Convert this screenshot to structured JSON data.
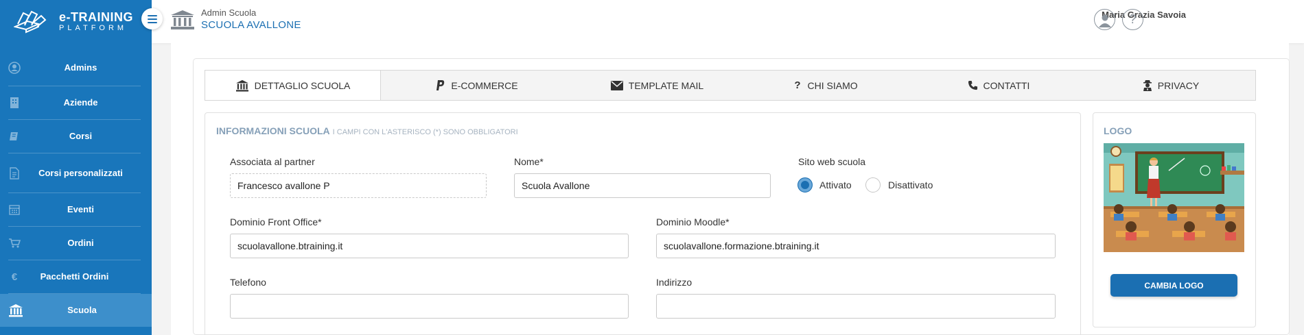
{
  "brand": {
    "title": "e-TRAINING",
    "subtitle": "PLATFORM"
  },
  "header": {
    "role": "Admin Scuola",
    "school": "SCUOLA AVALLONE",
    "user": "Maria Grazia Savoia",
    "help": "?"
  },
  "sidebar": {
    "items": [
      {
        "label": "Admins",
        "icon": "user-circle-icon"
      },
      {
        "label": "Aziende",
        "icon": "building-icon"
      },
      {
        "label": "Corsi",
        "icon": "book-icon"
      },
      {
        "label": "Corsi personalizzati",
        "icon": "document-icon"
      },
      {
        "label": "Eventi",
        "icon": "calendar-icon"
      },
      {
        "label": "Ordini",
        "icon": "cart-icon"
      },
      {
        "label": "Pacchetti Ordini",
        "icon": "euro-icon"
      },
      {
        "label": "Scuola",
        "icon": "institution-icon",
        "active": true
      }
    ]
  },
  "tabs": [
    {
      "label": "DETTAGLIO SCUOLA",
      "icon": "institution-icon",
      "active": true
    },
    {
      "label": "E-COMMERCE",
      "icon": "paypal-icon"
    },
    {
      "label": "TEMPLATE MAIL",
      "icon": "envelope-icon"
    },
    {
      "label": "CHI SIAMO",
      "icon": "question-icon"
    },
    {
      "label": "CONTATTI",
      "icon": "phone-icon"
    },
    {
      "label": "PRIVACY",
      "icon": "user-secret-icon"
    }
  ],
  "form": {
    "title": "INFORMAZIONI SCUOLA",
    "note": "I CAMPI CON L'ASTERISCO (*) SONO OBBLIGATORI",
    "partner": {
      "label": "Associata al partner",
      "value": "Francesco avallone P"
    },
    "nome": {
      "label": "Nome*",
      "value": "Scuola Avallone"
    },
    "sito": {
      "label": "Sito web scuola",
      "options": [
        "Attivato",
        "Disattivato"
      ],
      "selected": "Attivato"
    },
    "front_office": {
      "label": "Dominio Front Office*",
      "value": "scuolavallone.btraining.it"
    },
    "moodle": {
      "label": "Dominio Moodle*",
      "value": "scuolavallone.formazione.btraining.it"
    },
    "telefono": {
      "label": "Telefono",
      "value": ""
    },
    "indirizzo": {
      "label": "Indirizzo",
      "value": ""
    }
  },
  "logo": {
    "title": "LOGO",
    "button": "CAMBIA LOGO"
  },
  "colors": {
    "primary": "#1b6fb2",
    "sidebar": "#1976bb",
    "sidebar_active": "#3d8fcb",
    "muted_title": "#86a0b8"
  }
}
